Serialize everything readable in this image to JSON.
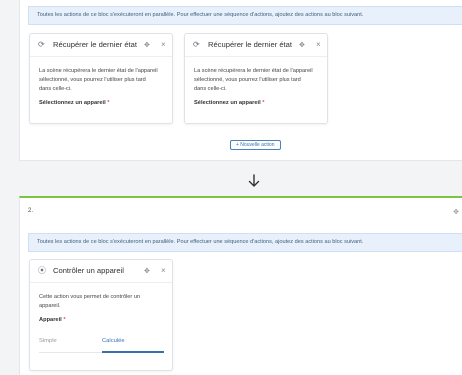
{
  "info_banner": "Toutes les actions de ce bloc s'exécuteront en parallèle. Pour effectuer une séquence d'actions, ajoutez des actions au bloc suivant.",
  "block1": {
    "cards": [
      {
        "title": "Récupérer le dernier état",
        "description": "La scène récupérera le dernier état de l'appareil sélectionné, vous pourrez l'utiliser plus tard dans celle-ci.",
        "field_label": "Sélectionnez un appareil",
        "required_mark": "*"
      },
      {
        "title": "Récupérer le dernier état",
        "description": "La scène récupérera le dernier état de l'appareil sélectionné, vous pourrez l'utiliser plus tard dans celle-ci.",
        "field_label": "Sélectionnez un appareil",
        "required_mark": "*"
      }
    ],
    "new_action_button": "+ Nouvelle action"
  },
  "block2": {
    "number": "2.",
    "card": {
      "title": "Contrôler un appareil",
      "description": "Cette action vous permet de contrôler un appareil.",
      "field_label": "Appareil",
      "required_mark": "*",
      "tabs": [
        "Simple",
        "Calculée"
      ],
      "active_tab": "Calculée"
    }
  },
  "icons": {
    "refresh": "refresh-icon",
    "move": "move-icon",
    "close": "close-icon",
    "device": "device-icon",
    "arrow": "arrow-down-icon",
    "drag": "drag-handle-icon"
  },
  "colors": {
    "accent": "#3a6fb0",
    "block_divider": "#7dc242",
    "info_bg": "#e8f1fb",
    "required": "#d9534f"
  }
}
